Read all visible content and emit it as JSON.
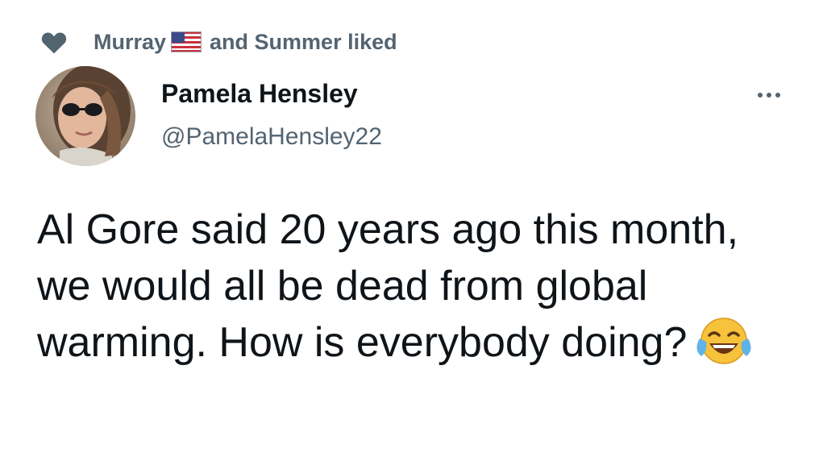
{
  "social_context": {
    "prefix": "Murray",
    "suffix": "and Summer liked",
    "flag_icon": "us-flag-icon",
    "heart_icon": "heart-icon"
  },
  "author": {
    "display_name": "Pamela Hensley",
    "handle": "@PamelaHensley22"
  },
  "more_icon": "more-horizontal-icon",
  "tweet": {
    "text": "Al Gore said 20 years ago this month, we would all be dead from global warming. How is everybody doing?",
    "emoji": "face-with-tears-of-joy-emoji"
  },
  "colors": {
    "text_primary": "#0f1419",
    "text_secondary": "#536471"
  }
}
